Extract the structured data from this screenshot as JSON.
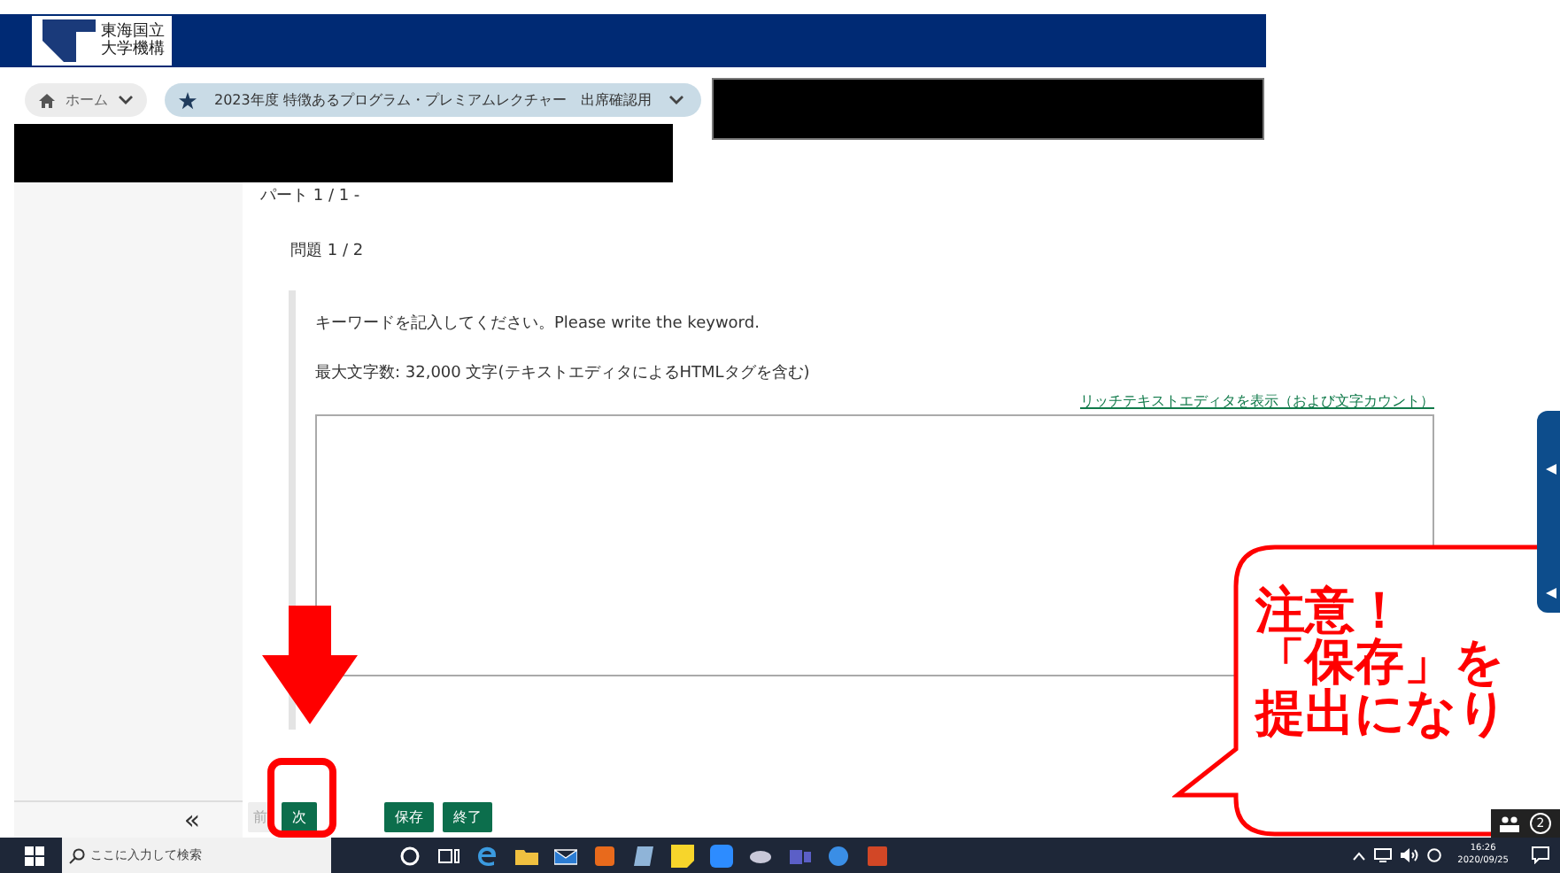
{
  "header": {
    "logo_lines": [
      "東海国立",
      "大学機構"
    ]
  },
  "breadcrumbs": [
    {
      "label": "ホーム"
    },
    {
      "label": "2023年度 特徴あるプログラム・プレミアムレクチャー　出席確認用"
    }
  ],
  "redactions": [
    {
      "kind": "redaction"
    },
    {
      "kind": "redaction"
    }
  ],
  "sidebar": {
    "collapse": "«"
  },
  "part": "パート 1 / 1 -",
  "question": "問題 1 / 2",
  "prompt": "キーワードを記入してください。Please write the keyword.",
  "limit": "最大文字数: 32,000 文字(テキストエディタによるHTMLタグを含む)",
  "rich_link": "リッチテキストエディタを表示（および文字カウント）",
  "buttons": [
    {
      "label": "前",
      "disabled": true
    },
    {
      "label": "次",
      "disabled": false
    },
    {
      "label": "保存",
      "disabled": false
    },
    {
      "label": "終了",
      "disabled": false
    }
  ],
  "callout": {
    "lines": [
      "注意！",
      "「保存」を",
      "提出になり"
    ]
  },
  "participants": {
    "count": "2"
  },
  "taskbar": {
    "search": {
      "placeholder": "ここに入力して検索"
    },
    "time": "16:26",
    "date": "2020/09/25"
  }
}
